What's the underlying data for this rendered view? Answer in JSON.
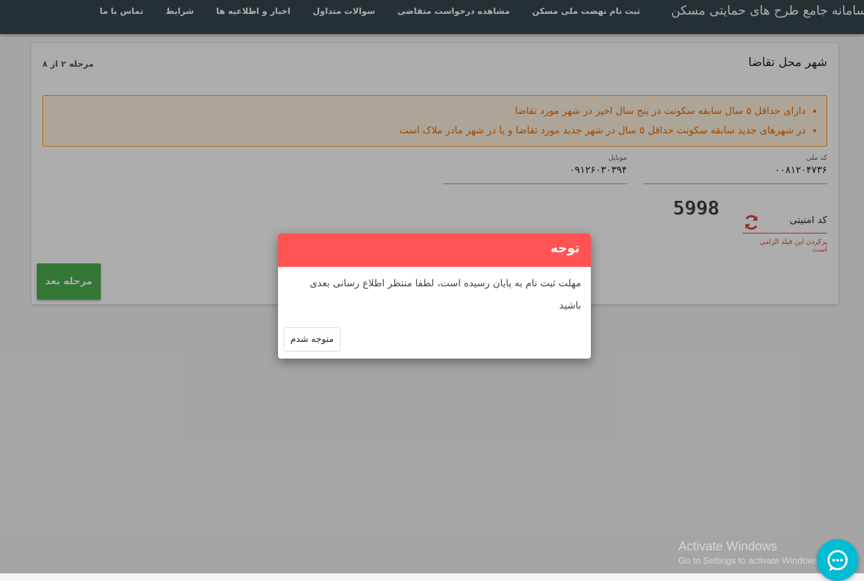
{
  "navbar": {
    "brand": "سامانه جامع طرح های حمایتی مسکن",
    "links": [
      "ثبت نام نهضت ملی مسکن",
      "مشاهده درخواست متقاضی",
      "سوالات متداول",
      "اخبار و اطلاعیه ها",
      "شرایط",
      "تماس با ما"
    ]
  },
  "card": {
    "title": "شهر محل تقاضا",
    "step": "مرحله ۲ از ۸",
    "notices": [
      "دارای حداقل ۵ سال سابقه سکونت در پنج سال اخیر در شهر مورد تقاضا",
      "در شهرهای جدید سابقه سکونت حداقل ۵ سال در شهر جدید مورد تقاضا و یا در شهر مادر ملاک است"
    ],
    "national_code": {
      "label": "کد ملی",
      "value": "۰۰۸۱۲۰۴۷۳۶"
    },
    "mobile": {
      "label": "موبایل",
      "value": "۰۹۱۲۶۰۳۰۳۹۴"
    },
    "captcha": {
      "image_text": "5998",
      "label": "کد امنیتی",
      "error": "پرکردن این فیلد الزامی است"
    },
    "next_button": "مرحله بعد"
  },
  "modal": {
    "title": "توجه",
    "message": "مهلت ثبت نام به پایان رسیده است، لطفا منتظر اطلاع رسانی بعدی باشید",
    "ok_button": "متوجه شدم"
  },
  "watermark": {
    "title": "Activate Windows",
    "subtitle": "Go to Settings to activate Windows."
  },
  "colors": {
    "navbar": "#37474f",
    "modal_header": "#ff5252",
    "next_button": "#4caf50",
    "notice_border": "#ff9800",
    "chat_button": "#00bcd4"
  }
}
